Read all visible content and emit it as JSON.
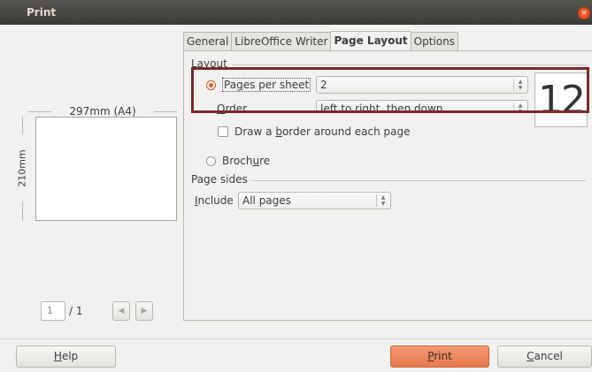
{
  "window": {
    "title": "Print",
    "close_glyph": "×"
  },
  "preview": {
    "width_label": "297mm (A4)",
    "height_label": "210mm",
    "page_current": "1",
    "page_total": "/ 1",
    "prev_glyph": "◀",
    "next_glyph": "▶"
  },
  "tabs": [
    {
      "label": "General",
      "active": false
    },
    {
      "label": "LibreOffice Writer",
      "active": false
    },
    {
      "label": "Page Layout",
      "active": true
    },
    {
      "label": "Options",
      "active": false
    }
  ],
  "layout": {
    "section_label": "Layout",
    "pages_per_sheet": {
      "pre": "Pa",
      "mnemonic": "g",
      "post": "es per sheet",
      "value": "2",
      "selected": true
    },
    "order": {
      "pre": "",
      "mnemonic": "O",
      "post": "rder",
      "value": "left to right, then down"
    },
    "draw_border": {
      "pre": "Draw a ",
      "mnemonic": "b",
      "post": "order around each page",
      "checked": false
    },
    "brochure": {
      "pre": "Broch",
      "mnemonic": "u",
      "post": "re",
      "selected": false
    },
    "thumbnail_text": "12"
  },
  "page_sides": {
    "section_label": "Page sides",
    "include": {
      "pre": "",
      "mnemonic": "I",
      "post": "nclude",
      "value": "All pages"
    }
  },
  "buttons": {
    "help": {
      "pre": "",
      "mnemonic": "H",
      "post": "elp"
    },
    "print": {
      "pre": "",
      "mnemonic": "P",
      "post": "rint"
    },
    "cancel": {
      "pre": "",
      "mnemonic": "C",
      "post": "ancel"
    }
  },
  "colors": {
    "accent": "#e7784c",
    "highlight_box": "#7a2a2a",
    "titlebar": "#3c3b37"
  }
}
